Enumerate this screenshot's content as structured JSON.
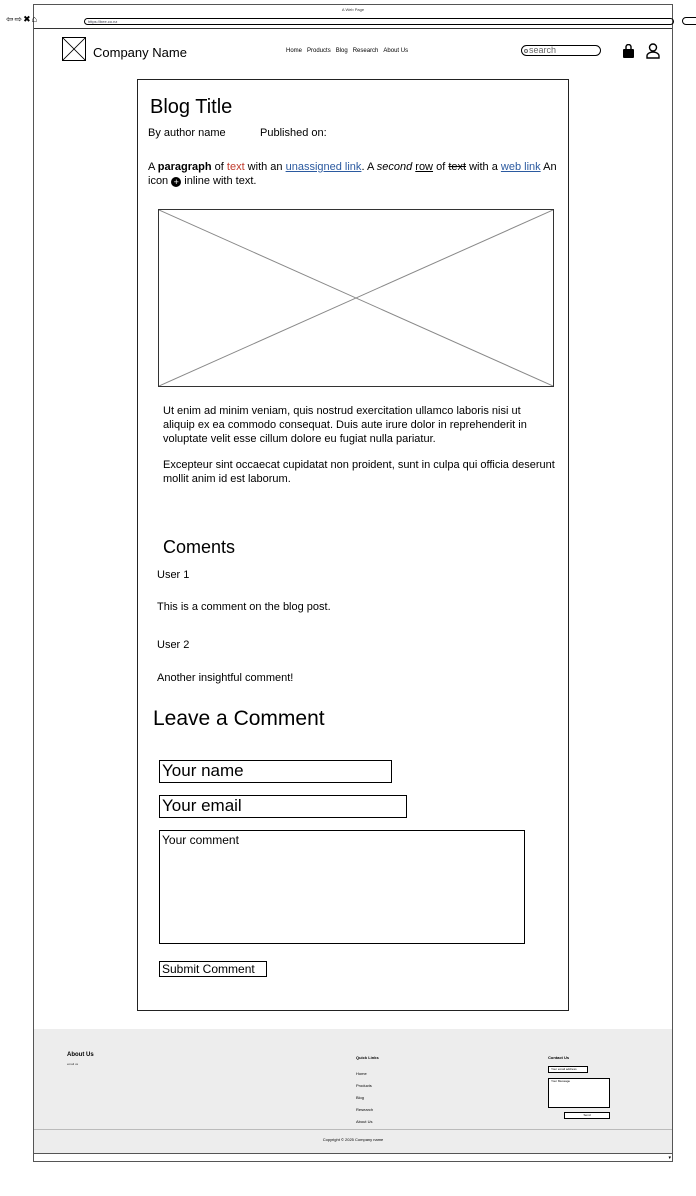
{
  "window": {
    "title": "A Web Page",
    "url": "https://bee.co.nz",
    "nav_icons": "⇦⇨✖⌂"
  },
  "header": {
    "company": "Company Name",
    "menu": [
      "Home",
      "Products",
      "Blog",
      "Research",
      "About Us"
    ],
    "search_placeholder": "search"
  },
  "article": {
    "title": "Blog Title",
    "author": "By author name",
    "published": "Published on:",
    "para": {
      "a": "A ",
      "bold": "paragraph",
      "of": " of ",
      "red": "text",
      "with": " with an ",
      "link1": "unassigned link",
      "mid": ". A ",
      "italic": "second",
      "sp": " ",
      "row": "row",
      "of2": " of ",
      "strike": "text",
      "with2": " with a ",
      "link2": "web link",
      "icon_text": " An icon ",
      "icon_glyph": "+",
      "tail": " inline with text."
    },
    "lorem1": "Ut enim ad minim veniam, quis nostrud exercitation ullamco laboris nisi ut aliquip ex ea commodo consequat. Duis aute irure dolor in reprehenderit in voluptate velit esse cillum dolore eu fugiat nulla pariatur.",
    "lorem2": "Excepteur sint occaecat cupidatat non proident, sunt in culpa qui officia deserunt mollit anim id est laborum.",
    "comments_heading": "Coments",
    "comments": [
      {
        "user": "User 1",
        "text": "This is a comment on the blog post."
      },
      {
        "user": "User 2",
        "text": "Another insightful comment!"
      }
    ],
    "leave_heading": "Leave a Comment",
    "name_field": "Your name",
    "email_field": "Your email",
    "comment_field": "Your comment",
    "submit": "Submit Comment"
  },
  "footer": {
    "about": "About Us",
    "email": "email us",
    "quick_links_heading": "Quick Links",
    "quick_links": [
      "Home",
      "Products",
      "Blog",
      "Research",
      "About Us"
    ],
    "contact_heading": "Contact Us",
    "contact_email": "Your email address",
    "contact_message": "Your Message",
    "send": "Send",
    "copyright": "Copyright © 2025 Company name"
  }
}
